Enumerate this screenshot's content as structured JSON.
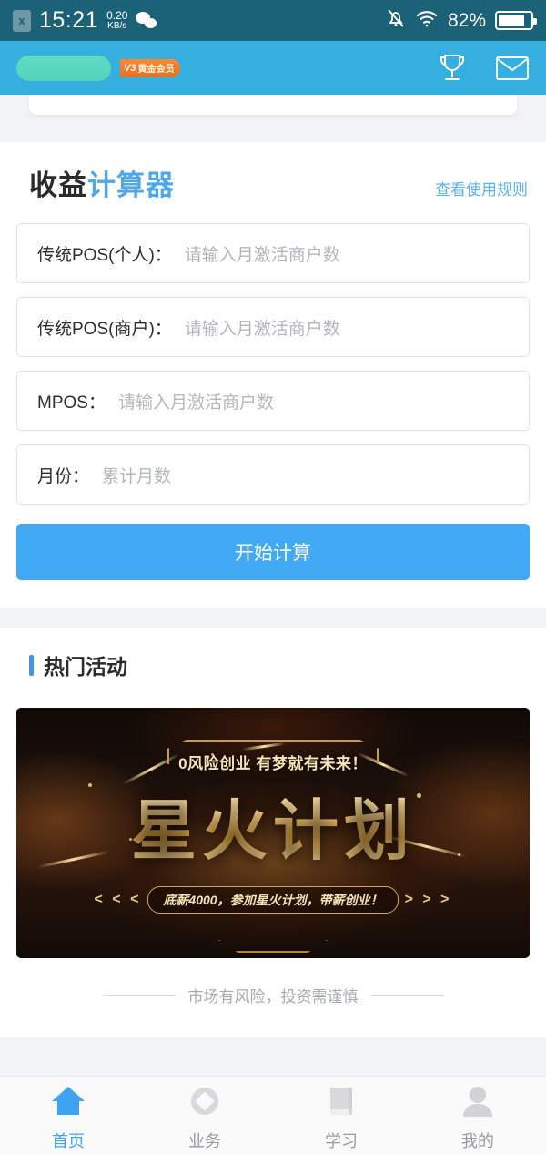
{
  "status_bar": {
    "sim_label": "x",
    "time": "15:21",
    "net_speed_value": "0.20",
    "net_speed_unit": "KB/s",
    "wechat_icon": "wechat-icon",
    "mute_icon": "bell-mute-icon",
    "wifi_icon": "wifi-icon",
    "battery_percent": "82%",
    "battery_icon": "battery-icon"
  },
  "header": {
    "username_redacted": "",
    "vip_level": "V3",
    "vip_label": "黄金会员",
    "trophy_icon": "trophy-icon",
    "mail_icon": "mail-icon"
  },
  "calculator": {
    "title_plain": "收益",
    "title_accent": "计算器",
    "rules_link": "查看使用规则",
    "fields": [
      {
        "label": "传统POS(个人)：",
        "placeholder": "请输入月激活商户数",
        "value": ""
      },
      {
        "label": "传统POS(商户)：",
        "placeholder": "请输入月激活商户数",
        "value": ""
      },
      {
        "label": "MPOS：",
        "placeholder": "请输入月激活商户数",
        "value": ""
      },
      {
        "label": "月份：",
        "placeholder": "累计月数",
        "value": ""
      }
    ],
    "submit_label": "开始计算"
  },
  "hot_activity": {
    "section_title": "热门活动",
    "banner": {
      "subtitle": "0风险创业  有梦就有未来！",
      "main_title": "星火计划",
      "ribbon_left": "< < <",
      "ribbon_text": "底薪4000，参加星火计划，带薪创业！",
      "ribbon_right": "> > >"
    }
  },
  "disclaimer": {
    "text": "市场有风险，投资需谨慎"
  },
  "tabbar": {
    "items": [
      {
        "label": "首页",
        "icon": "home-icon",
        "active": true
      },
      {
        "label": "业务",
        "icon": "diamond-icon",
        "active": false
      },
      {
        "label": "学习",
        "icon": "book-icon",
        "active": false
      },
      {
        "label": "我的",
        "icon": "person-icon",
        "active": false
      }
    ]
  },
  "colors": {
    "status_bar_bg": "#1b6278",
    "header_bg": "#35aee0",
    "accent_blue": "#4da7e8",
    "link_blue": "#5cb3e8",
    "button_blue": "#42aaf5",
    "vip_orange": "#ee6f1e",
    "redact_green": "#5fdcc2",
    "page_bg": "#f2f3f5"
  }
}
